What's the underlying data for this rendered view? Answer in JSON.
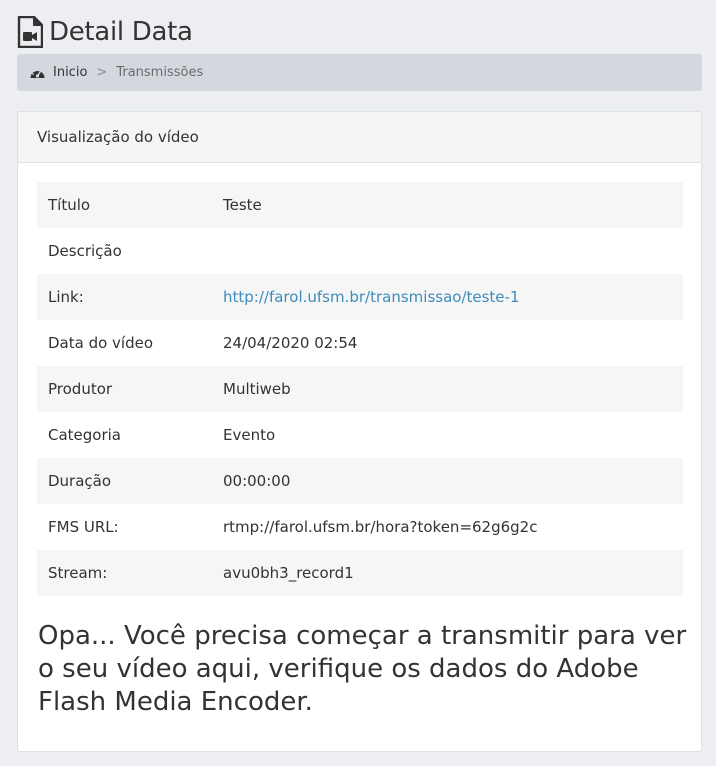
{
  "header": {
    "title": "Detail Data",
    "icon": "video-file-icon"
  },
  "breadcrumb": {
    "home_label": "Inicio",
    "separator": ">",
    "current_label": "Transmissões"
  },
  "panel": {
    "heading": "Visualização do vídeo",
    "rows": [
      {
        "label": "Título",
        "value": "Teste"
      },
      {
        "label": "Descrição",
        "value": ""
      },
      {
        "label": "Link:",
        "value": "http://farol.ufsm.br/transmissao/teste-1"
      },
      {
        "label": "Data do vídeo",
        "value": "24/04/2020 02:54"
      },
      {
        "label": "Produtor",
        "value": "Multiweb"
      },
      {
        "label": "Categoria",
        "value": "Evento"
      },
      {
        "label": "Duração",
        "value": "00:00:00"
      },
      {
        "label": "FMS URL:",
        "value": "rtmp://farol.ufsm.br/hora?token=62g6g2c"
      },
      {
        "label": "Stream:",
        "value": "avu0bh3_record1"
      }
    ],
    "notice": "Opa... Você precisa começar a transmitir para ver o seu vídeo aqui, verifique os dados do Adobe Flash Media Encoder."
  },
  "colors": {
    "link": "#3c8dbc",
    "background": "#eceef1",
    "breadcrumb_bg": "#d3d7de"
  }
}
